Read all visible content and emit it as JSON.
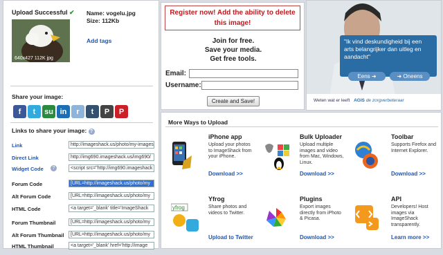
{
  "left": {
    "upload_title": "Upload Successful",
    "check": "✔",
    "name": "Name: vogelu.jpg",
    "size": "Size: 112Kb",
    "add_tags": "Add tags",
    "thumb_caption": "640x427 112K jpg",
    "share_title": "Share your image:",
    "links_title": "Links to share your image:",
    "help_glyph": "?",
    "share_icons": [
      {
        "label": "f",
        "color": "#3b5998",
        "icon": "facebook-icon"
      },
      {
        "label": "t",
        "color": "#33aadd",
        "icon": "twitter-icon"
      },
      {
        "label": "su",
        "color": "#2b8a3e",
        "icon": "stumbleupon-icon"
      },
      {
        "label": "in",
        "color": "#1d6fb5",
        "icon": "linkedin-icon"
      },
      {
        "label": "r",
        "color": "#8fb3d9",
        "icon": "reddit-icon"
      },
      {
        "label": "t",
        "color": "#34526f",
        "icon": "tumblr-icon"
      },
      {
        "label": "P",
        "color": "#444444",
        "icon": "myspace-icon"
      },
      {
        "label": "P",
        "color": "#cb2027",
        "icon": "pinterest-icon"
      }
    ],
    "links": [
      {
        "label": "Link",
        "blue": true,
        "value": "http://imageshack.us/photo/my-images/",
        "sel": false
      },
      {
        "label": "Direct Link",
        "blue": true,
        "value": "http://img690.imageshack.us/img690/",
        "sel": false
      },
      {
        "label": "Widget Code",
        "blue": true,
        "value": "<script src=\"http://img690.imageshack",
        "sel": false,
        "help": true
      },
      {
        "label": "Forum Code",
        "blue": false,
        "value": "[URL=http://imageshack.us/photo/my",
        "sel": true
      },
      {
        "label": "Alt Forum Code",
        "blue": false,
        "value": "[URL=http://imageshack.us/photo/my",
        "sel": false
      },
      {
        "label": "HTML Code",
        "blue": false,
        "value": "<a target='_blank' title='ImageShack",
        "sel": false
      },
      {
        "label": "Forum Thumbnail",
        "blue": false,
        "value": "[URL=http://imageshack.us/photo/my",
        "sel": false
      },
      {
        "label": "Alt Forum Thumbnail",
        "blue": false,
        "value": "[URL=http://imageshack.us/photo/my",
        "sel": false
      },
      {
        "label": "HTML Thumbnail",
        "blue": false,
        "value": "<a target='_blank' href='http://image",
        "sel": false
      }
    ]
  },
  "register": {
    "headline": "Register now! Add the ability to delete this image!",
    "line1": "Join for free.",
    "line2": "Save your media.",
    "line3": "Get free tools.",
    "email_label": "Email:",
    "username_label": "Username:",
    "button": "Create and Save!"
  },
  "ad": {
    "bubble": "\"Ik vind deskundigheid bij een arts belangrijker dan uitleg en aandacht\"",
    "eens": "Eens",
    "oneens": "Oneens",
    "footer_left": "Weten wat er leeft",
    "footer_brand": "AGIS",
    "footer_right": "de zorgverbeteraar"
  },
  "ways": {
    "title": "More Ways to Upload",
    "tiles": [
      {
        "title": "iPhone app",
        "desc": "Upload your photos to ImageShack from your iPhone.",
        "link": "Download >>",
        "icon": "iphone-icon"
      },
      {
        "title": "Bulk Uploader",
        "desc": "Upload multiple images and video from Mac, Windows, Linux.",
        "link": "Download >>",
        "icon": "os-logos-icon"
      },
      {
        "title": "Toolbar",
        "desc": "Supports Firefox and Internet Explorer.",
        "link": "Download >>",
        "icon": "browser-icon"
      },
      {
        "title": "Yfrog",
        "desc": "Share photos and videos to Twitter.",
        "link": "Upload to Twitter",
        "icon": "yfrog-icon"
      },
      {
        "title": "Plugins",
        "desc": "Export images directly from iPhoto & Picasa.",
        "link": "Download >>",
        "icon": "picasa-icon"
      },
      {
        "title": "API",
        "desc": "Developers! Host images via ImageShack transparently.",
        "link": "Learn more >>",
        "icon": "api-icon"
      }
    ]
  }
}
